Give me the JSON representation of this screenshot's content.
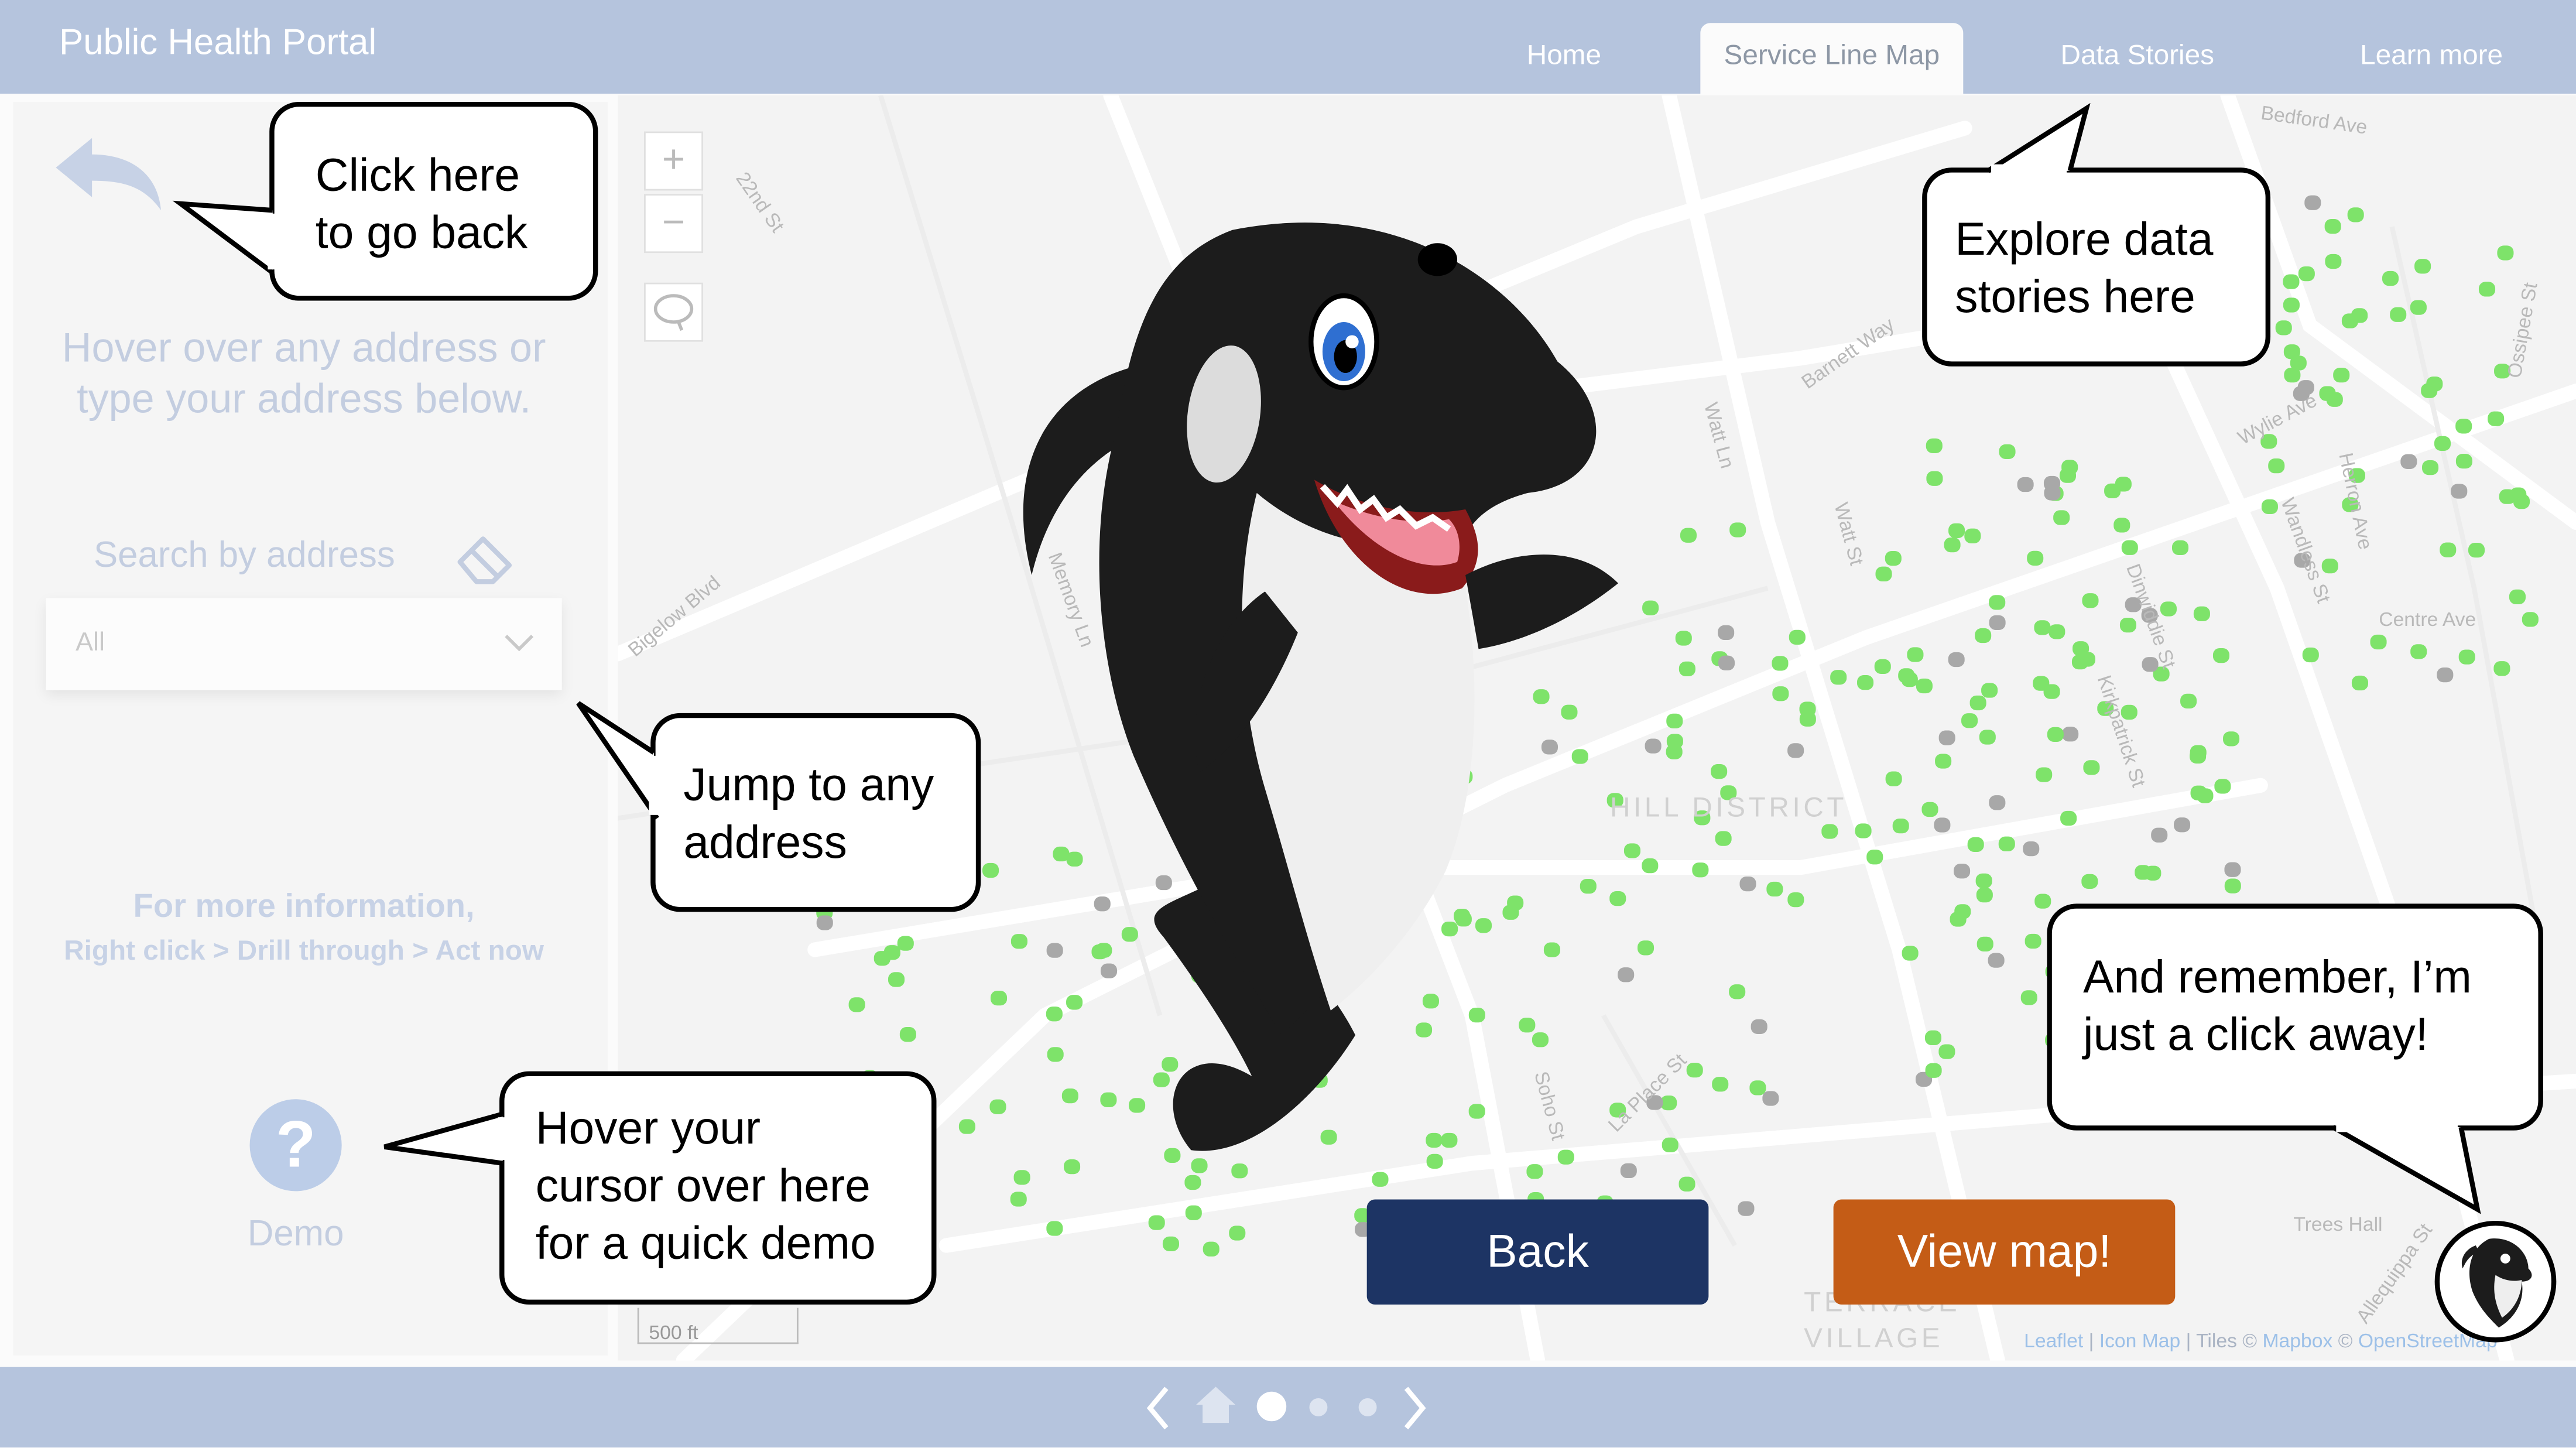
{
  "header": {
    "portal_title": "Public Health Portal",
    "tabs": [
      {
        "label": "Home",
        "active": false
      },
      {
        "label": "Service Line Map",
        "active": true
      },
      {
        "label": "Data Stories",
        "active": false
      },
      {
        "label": "Learn more",
        "active": false
      }
    ]
  },
  "left_panel": {
    "hover_instruction_line1": "Hover over any address or",
    "hover_instruction_line2": "type your address below.",
    "search_label": "Search by address",
    "dropdown_value": "All",
    "info_line1": "For more information,",
    "info_line2": "Right click > Drill through > Act now",
    "demo_label": "Demo"
  },
  "map": {
    "zoom_in": "+",
    "zoom_out": "−",
    "scale_label": "500 ft",
    "streets": [
      "22nd St",
      "Bigelow Blvd",
      "Memory Ln",
      "Watt Ln",
      "Barnett Way",
      "Wylie Ave",
      "Herron Ave",
      "Wandless St",
      "Centre Ave",
      "Ossipee St",
      "Soho St",
      "La Place St",
      "Trees Hall",
      "Allequippa St",
      "Bedford Ave",
      "Watt St",
      "Dinwiddie St",
      "Kirkpatrick St"
    ],
    "districts": [
      "HILL DISTRICT",
      "TERRACE VILLAGE"
    ],
    "attribution": {
      "leaflet": "Leaflet",
      "sep1": " | ",
      "iconmap": "Icon Map",
      "tiles": " | Tiles © ",
      "mapbox": "Mapbox",
      "copy": " © ",
      "osm": "OpenStreetMap"
    }
  },
  "callouts": {
    "go_back": [
      "Click here",
      "to go back"
    ],
    "data_stories": [
      "Explore data",
      "stories here"
    ],
    "jump_address": [
      "Jump to any",
      "address"
    ],
    "demo": [
      "Hover your",
      "cursor over here",
      "for a quick demo"
    ],
    "click_away": [
      "And remember, I’m",
      "just a click away!"
    ]
  },
  "buttons": {
    "back": "Back",
    "view_map": "View map!"
  },
  "pager": {
    "pages": 3,
    "current": 1
  },
  "colors": {
    "header_bg": "#b5c4dd",
    "back_button": "#1d3464",
    "view_map_button": "#c45c16",
    "service_line_green": "#7ee36a",
    "service_line_gray": "#a8a8a8"
  },
  "icons": [
    "back-arrow-icon",
    "eraser-icon",
    "chevron-down-icon",
    "question-icon",
    "lasso-icon",
    "home-icon",
    "chevron-left-icon",
    "chevron-right-icon",
    "orca-mascot"
  ]
}
